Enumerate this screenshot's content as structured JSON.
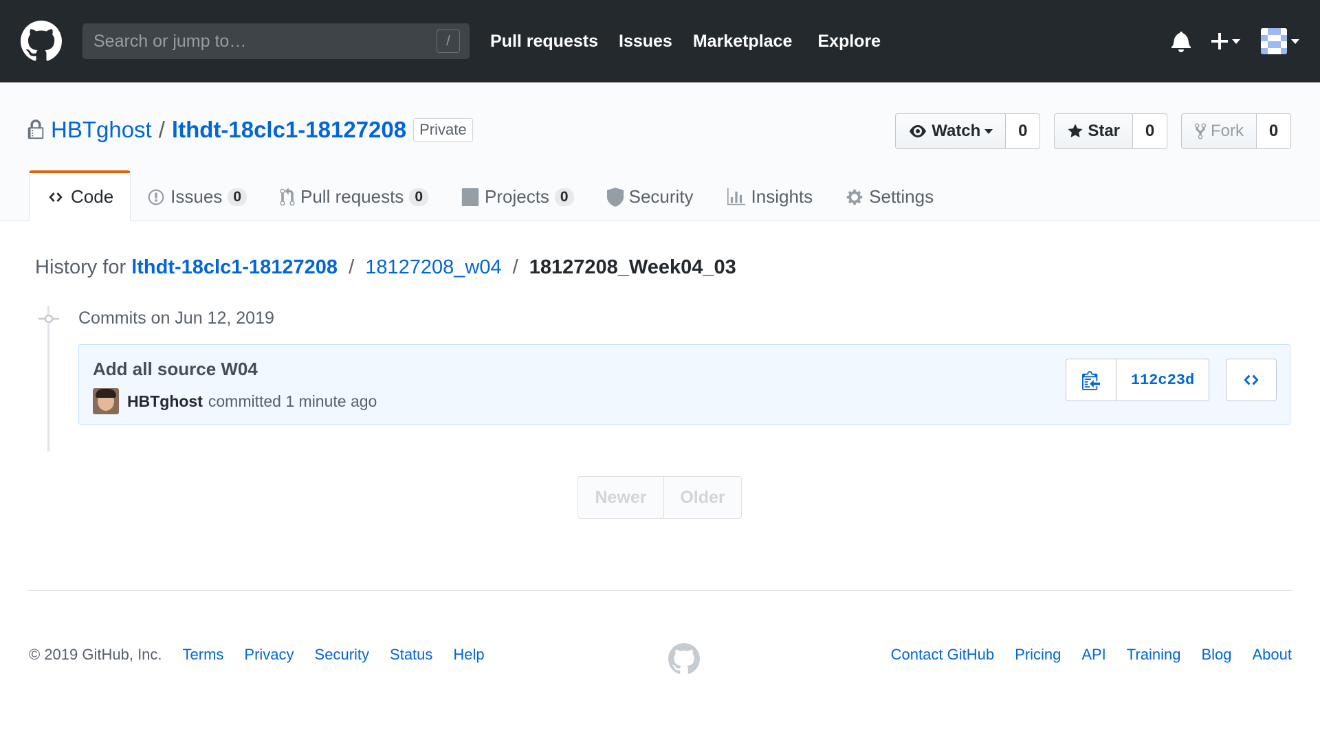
{
  "header": {
    "search_placeholder": "Search or jump to…",
    "search_shortcut": "/",
    "nav": [
      "Pull requests",
      "Issues",
      "Marketplace",
      "Explore"
    ]
  },
  "repo": {
    "owner": "HBTghost",
    "separator": "/",
    "name": "lthdt-18clc1-18127208",
    "visibility": "Private",
    "watch_label": "Watch",
    "watch_count": "0",
    "star_label": "Star",
    "star_count": "0",
    "fork_label": "Fork",
    "fork_count": "0"
  },
  "tabs": {
    "code": "Code",
    "issues": "Issues",
    "issues_count": "0",
    "pulls": "Pull requests",
    "pulls_count": "0",
    "projects": "Projects",
    "projects_count": "0",
    "security": "Security",
    "insights": "Insights",
    "settings": "Settings"
  },
  "history": {
    "prefix": "History for",
    "root": "lthdt-18clc1-18127208",
    "folder": "18127208_w04",
    "file": "18127208_Week04_03",
    "date_heading": "Commits on Jun 12, 2019"
  },
  "commit": {
    "title": "Add all source W04",
    "author": "HBTghost",
    "action": "committed 1 minute ago",
    "sha": "112c23d"
  },
  "pagination": {
    "newer": "Newer",
    "older": "Older"
  },
  "footer": {
    "copyright": "© 2019 GitHub, Inc.",
    "left_links": [
      "Terms",
      "Privacy",
      "Security",
      "Status",
      "Help"
    ],
    "right_links": [
      "Contact GitHub",
      "Pricing",
      "API",
      "Training",
      "Blog",
      "About"
    ]
  },
  "colors": {
    "header_bg": "#24292e",
    "link": "#0366d6",
    "selected_tab_accent": "#e36209",
    "commit_box_bg": "#f1f8ff"
  }
}
